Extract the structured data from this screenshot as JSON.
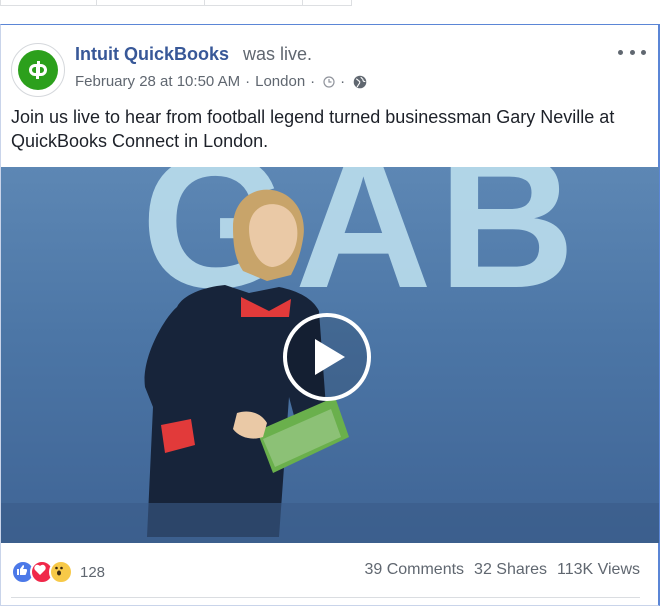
{
  "post": {
    "page_name": "Intuit QuickBooks",
    "live_label": "was live.",
    "date": "February 28 at 10:50 AM",
    "location": "London",
    "separator": "·",
    "text": "Join us live to hear from football legend turned businessman Gary Neville at QuickBooks Connect in London.",
    "brand_color": "#2ca01c"
  },
  "video": {
    "stage_letters": "GAB",
    "play_icon": "play-icon"
  },
  "footer": {
    "reaction_count": "128",
    "comments": "39 Comments",
    "shares": "32 Shares",
    "views": "113K Views",
    "reaction_icons": [
      "like-icon",
      "love-icon",
      "wow-icon"
    ]
  }
}
